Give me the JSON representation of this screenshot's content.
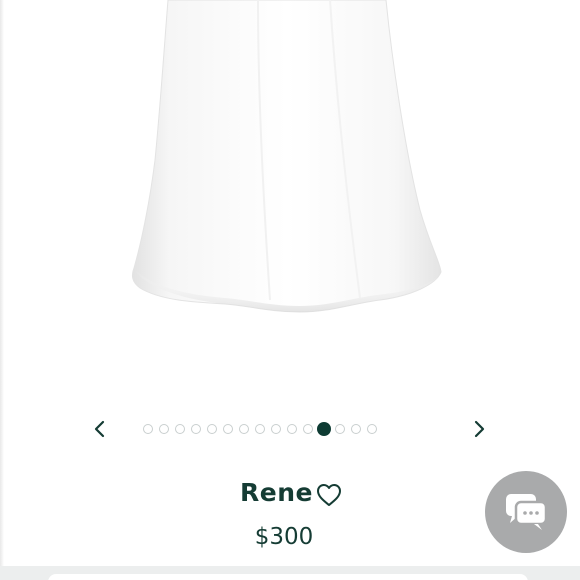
{
  "product": {
    "name": "Rene",
    "price": "$300"
  },
  "carousel": {
    "total_images": 15,
    "active_index": 11,
    "prev_icon": "chevron-left-icon",
    "next_icon": "chevron-right-icon"
  },
  "icons": {
    "favorite": "heart-outline-icon",
    "chat": "chat-bubble-icon"
  },
  "colors": {
    "brand_dark_green": "#153c34",
    "active_dot": "#0e3b33",
    "inactive_dot_border": "#c9cfcf",
    "chat_button": "#a9aaab",
    "dress": "#ffffff"
  }
}
